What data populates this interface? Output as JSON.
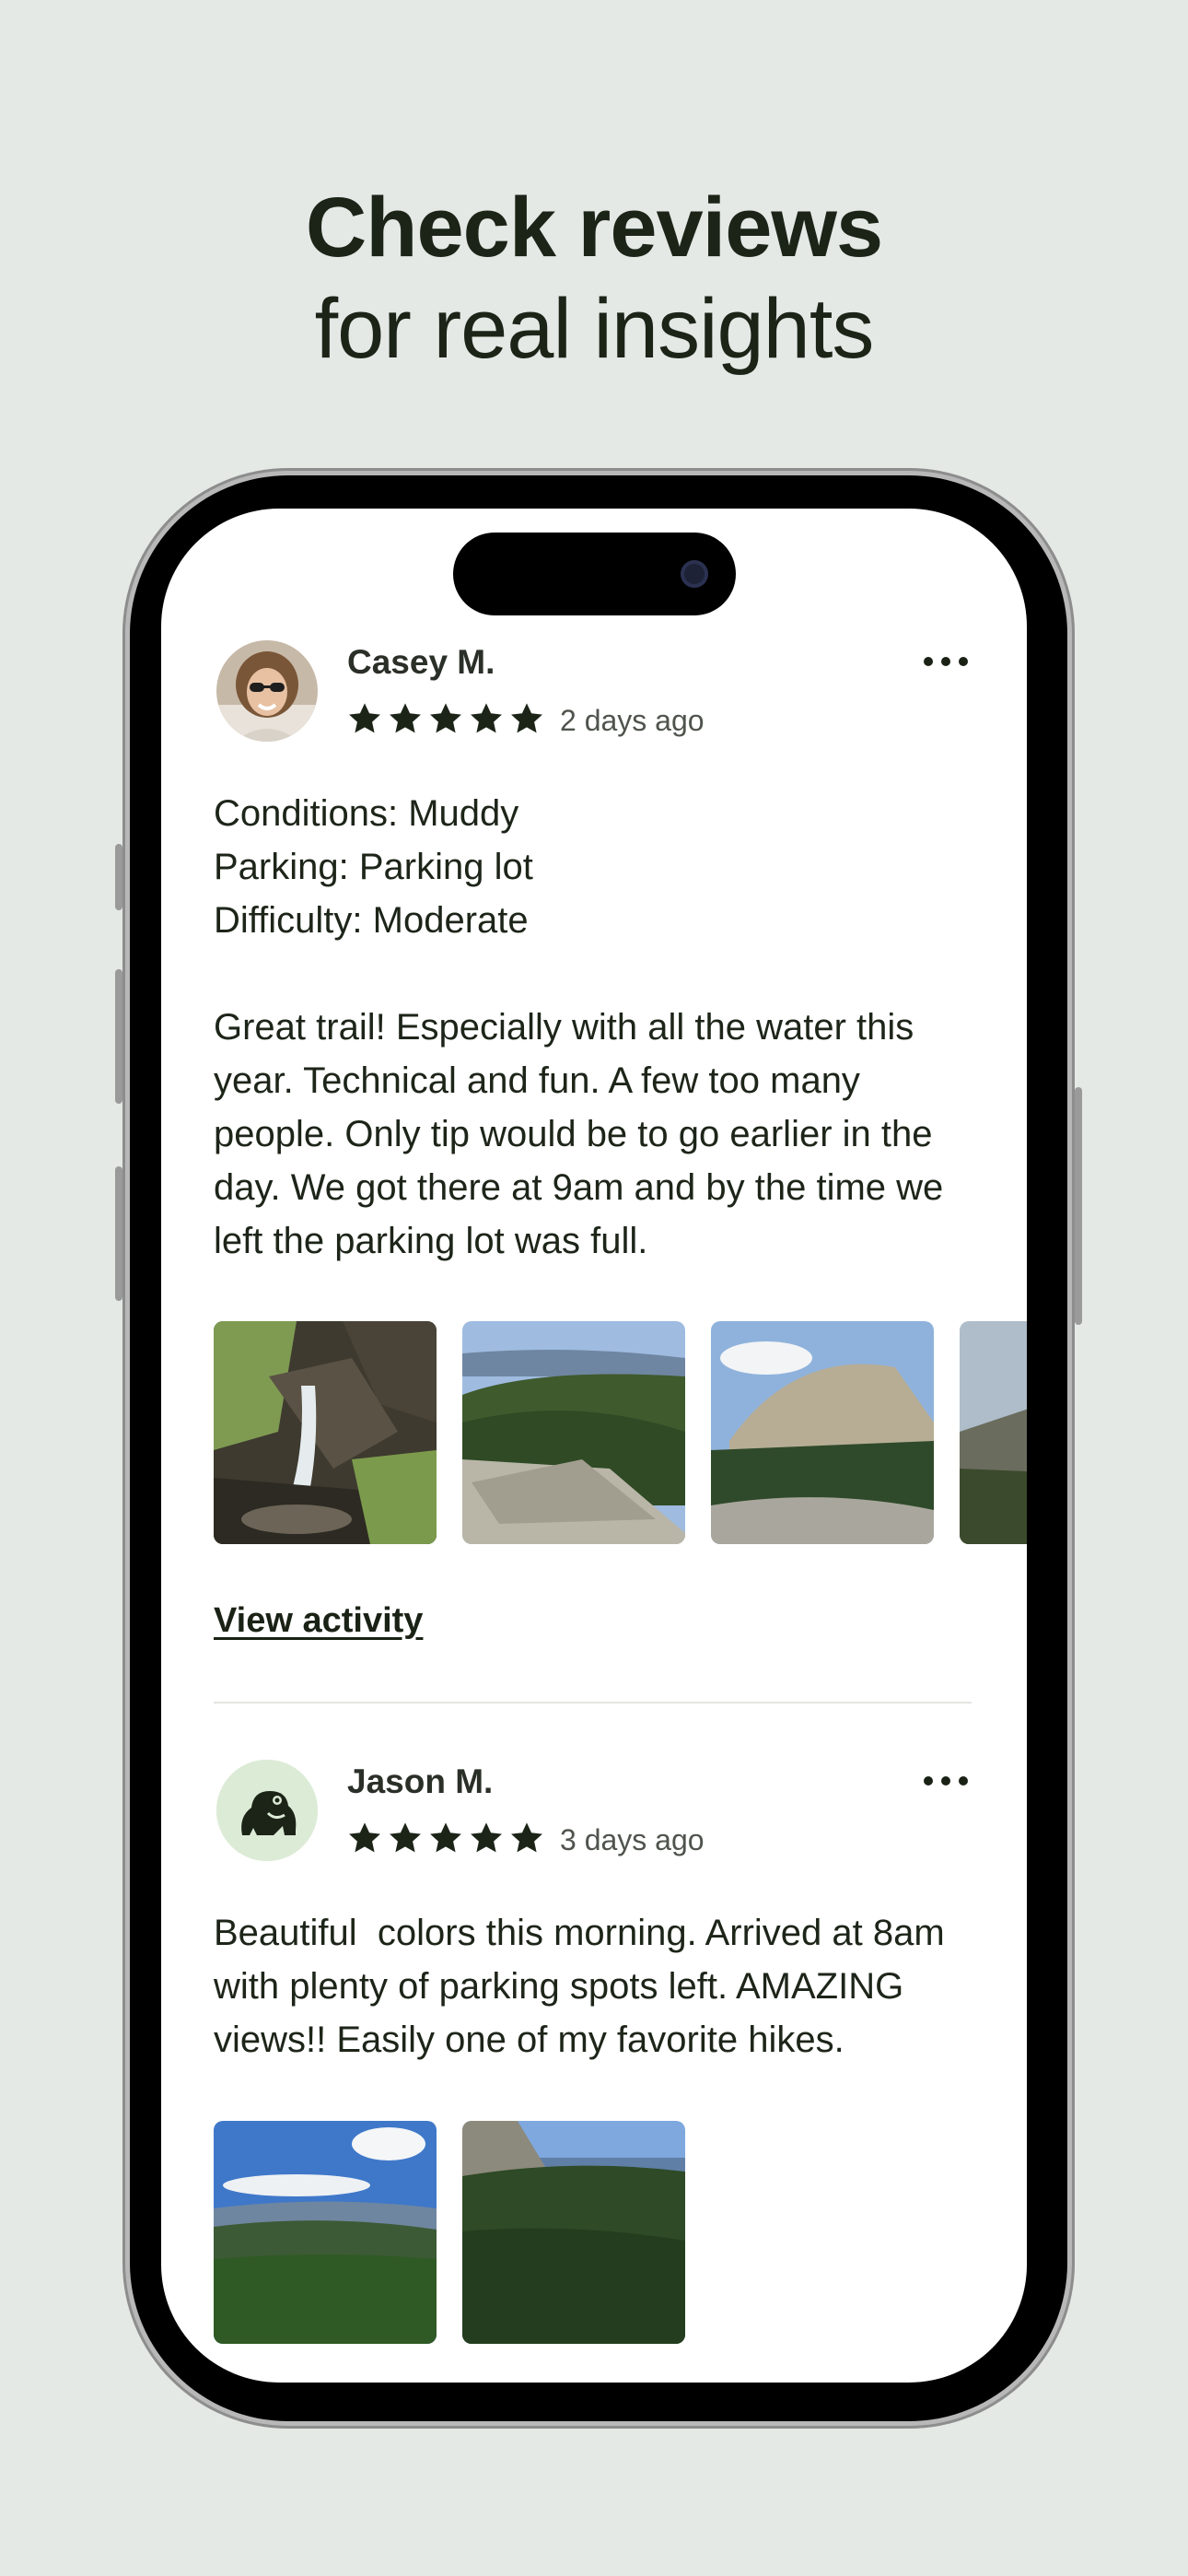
{
  "headline": {
    "line1": "Check reviews",
    "line2": "for real insights"
  },
  "reviews": [
    {
      "name": "Casey M.",
      "rating": 5,
      "time_ago": "2 days ago",
      "conditions": "Conditions: Muddy",
      "parking": "Parking: Parking lot",
      "difficulty": "Difficulty: Moderate",
      "body": "Great trail! Especially with all the water this year. Technical and fun. A few too many people. Only tip would be to go earlier in the day. We got there at 9am and by the time we left the parking lot was full.",
      "photos": [
        "waterfall",
        "mountain-ridge",
        "granite-summit",
        "rocky-slope"
      ],
      "link": "View activity"
    },
    {
      "name": "Jason M.",
      "rating": 5,
      "time_ago": "3 days ago",
      "body": "Beautiful  colors this morning. Arrived at 8am with plenty of parking spots left. AMAZING views!! Easily one of my favorite hikes.",
      "photos": [
        "valley-view",
        "forested-peak"
      ],
      "avatar_icon": "frog-icon"
    }
  ],
  "colors": {
    "background": "#e4e9e5",
    "text": "#1a2216",
    "avatar_bg": "#dcebd6"
  }
}
